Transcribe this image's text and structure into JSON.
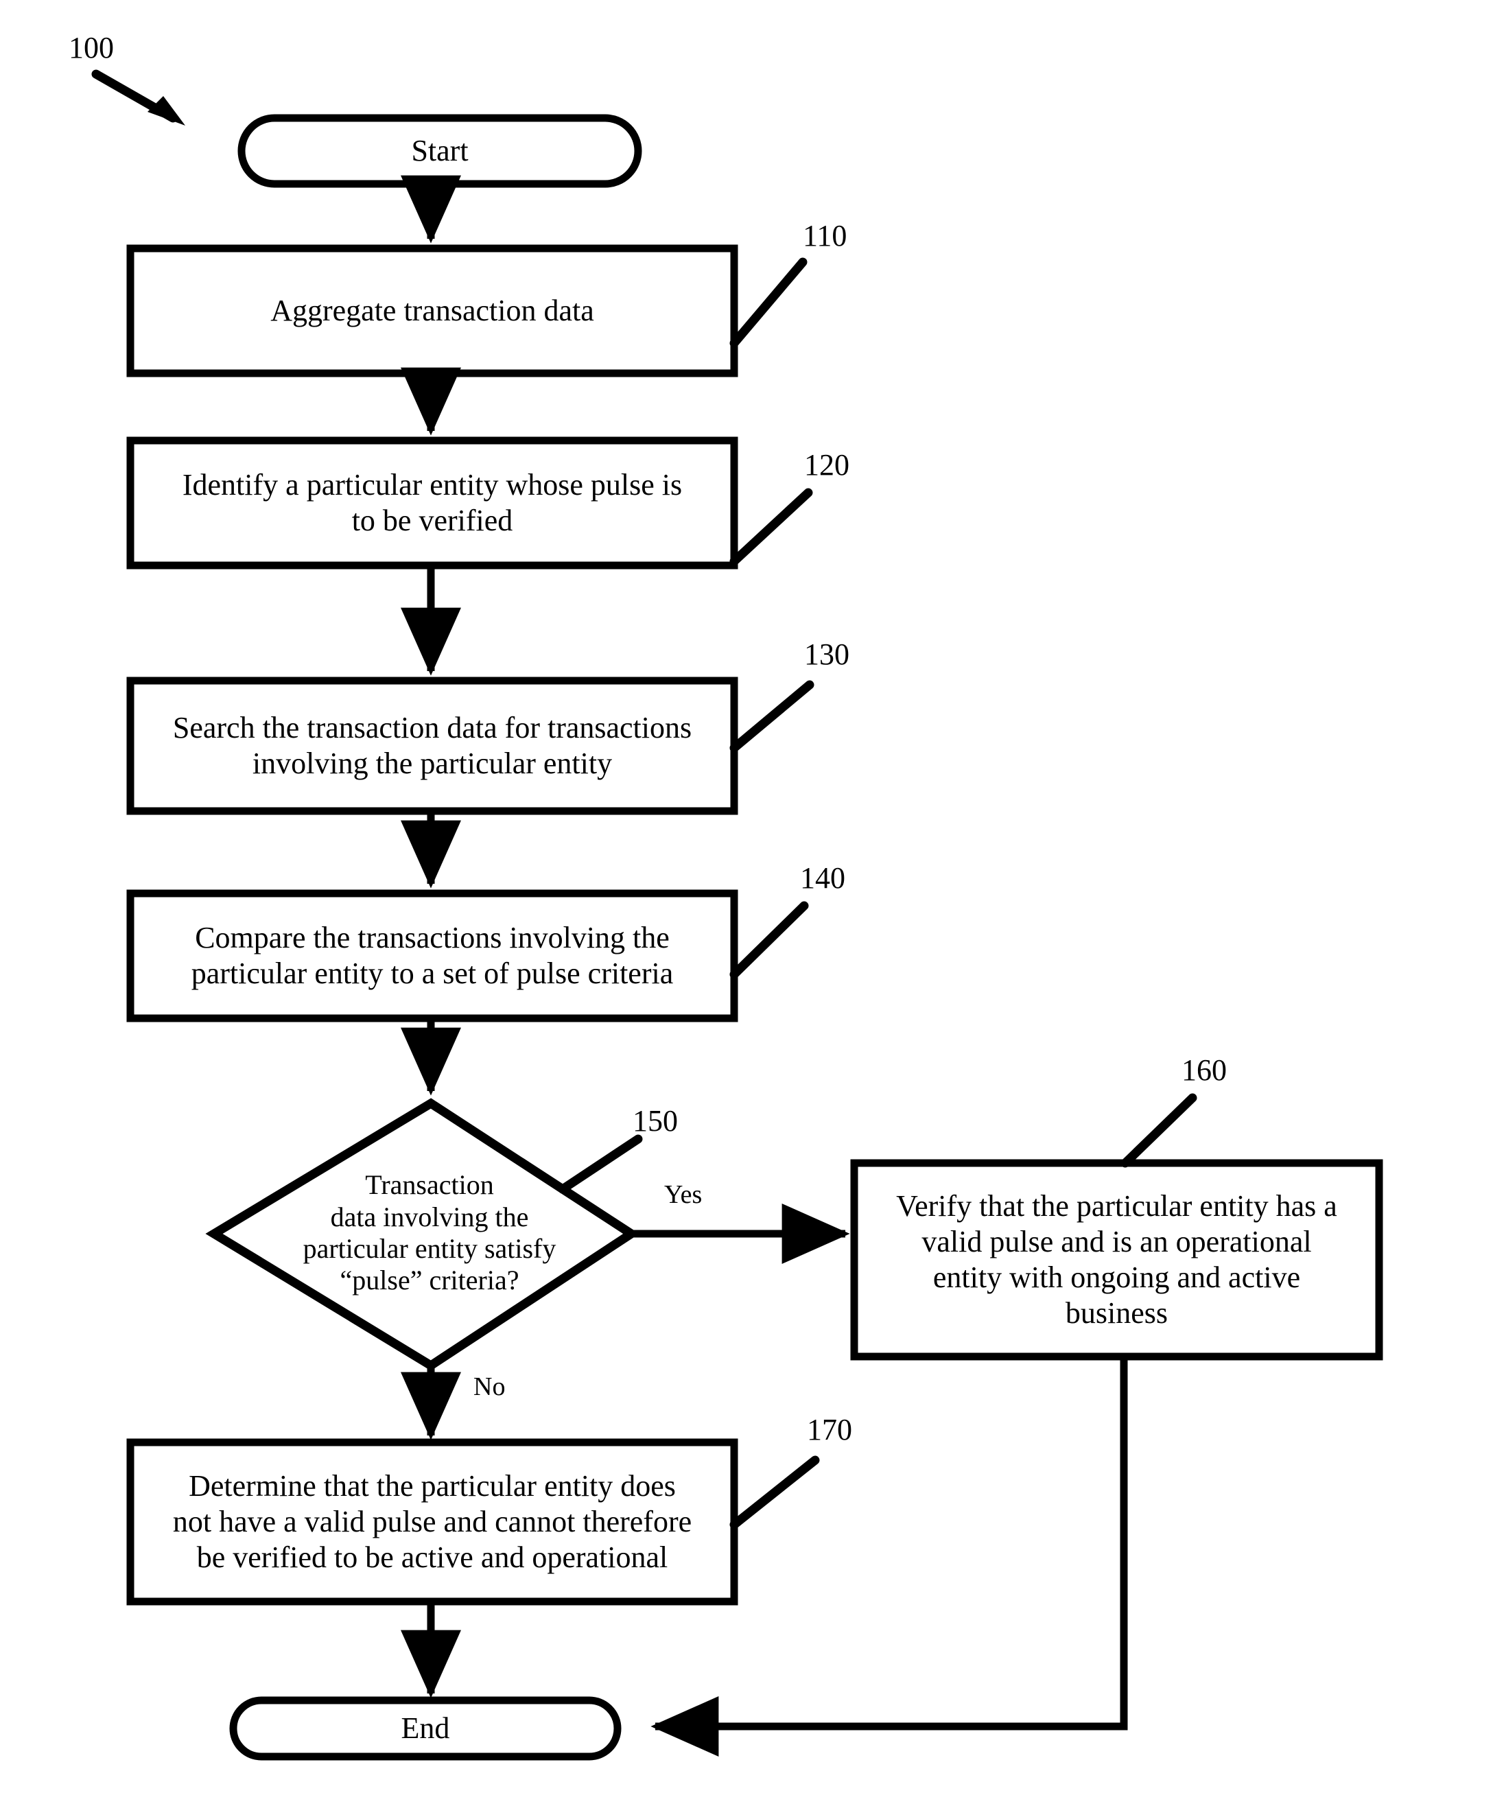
{
  "figure": {
    "reference_numeral": "100",
    "type": "flowchart"
  },
  "nodes": {
    "start": {
      "label": "Start",
      "shape": "terminal"
    },
    "step110": {
      "label": "Aggregate transaction data",
      "ref": "110",
      "shape": "process"
    },
    "step120": {
      "label": "Identify a particular entity whose pulse is\nto be verified",
      "ref": "120",
      "shape": "process"
    },
    "step130": {
      "label": "Search the transaction data for transactions\ninvolving the particular entity",
      "ref": "130",
      "shape": "process"
    },
    "step140": {
      "label": "Compare the transactions involving the\nparticular entity to a set of pulse criteria",
      "ref": "140",
      "shape": "process"
    },
    "decision150": {
      "label": "Transaction\ndata involving the\nparticular entity satisfy\n“pulse” criteria?",
      "ref": "150",
      "shape": "decision"
    },
    "step160": {
      "label": "Verify that the particular entity has a\nvalid pulse and is an operational\nentity with ongoing and active\nbusiness",
      "ref": "160",
      "shape": "process"
    },
    "step170": {
      "label": "Determine that the particular entity does\nnot have a valid pulse and cannot therefore\nbe verified to be active and operational",
      "ref": "170",
      "shape": "process"
    },
    "end": {
      "label": "End",
      "shape": "terminal"
    }
  },
  "edge_labels": {
    "yes": "Yes",
    "no": "No"
  },
  "colors": {
    "stroke": "#000000",
    "fill": "#ffffff",
    "text": "#000000"
  }
}
